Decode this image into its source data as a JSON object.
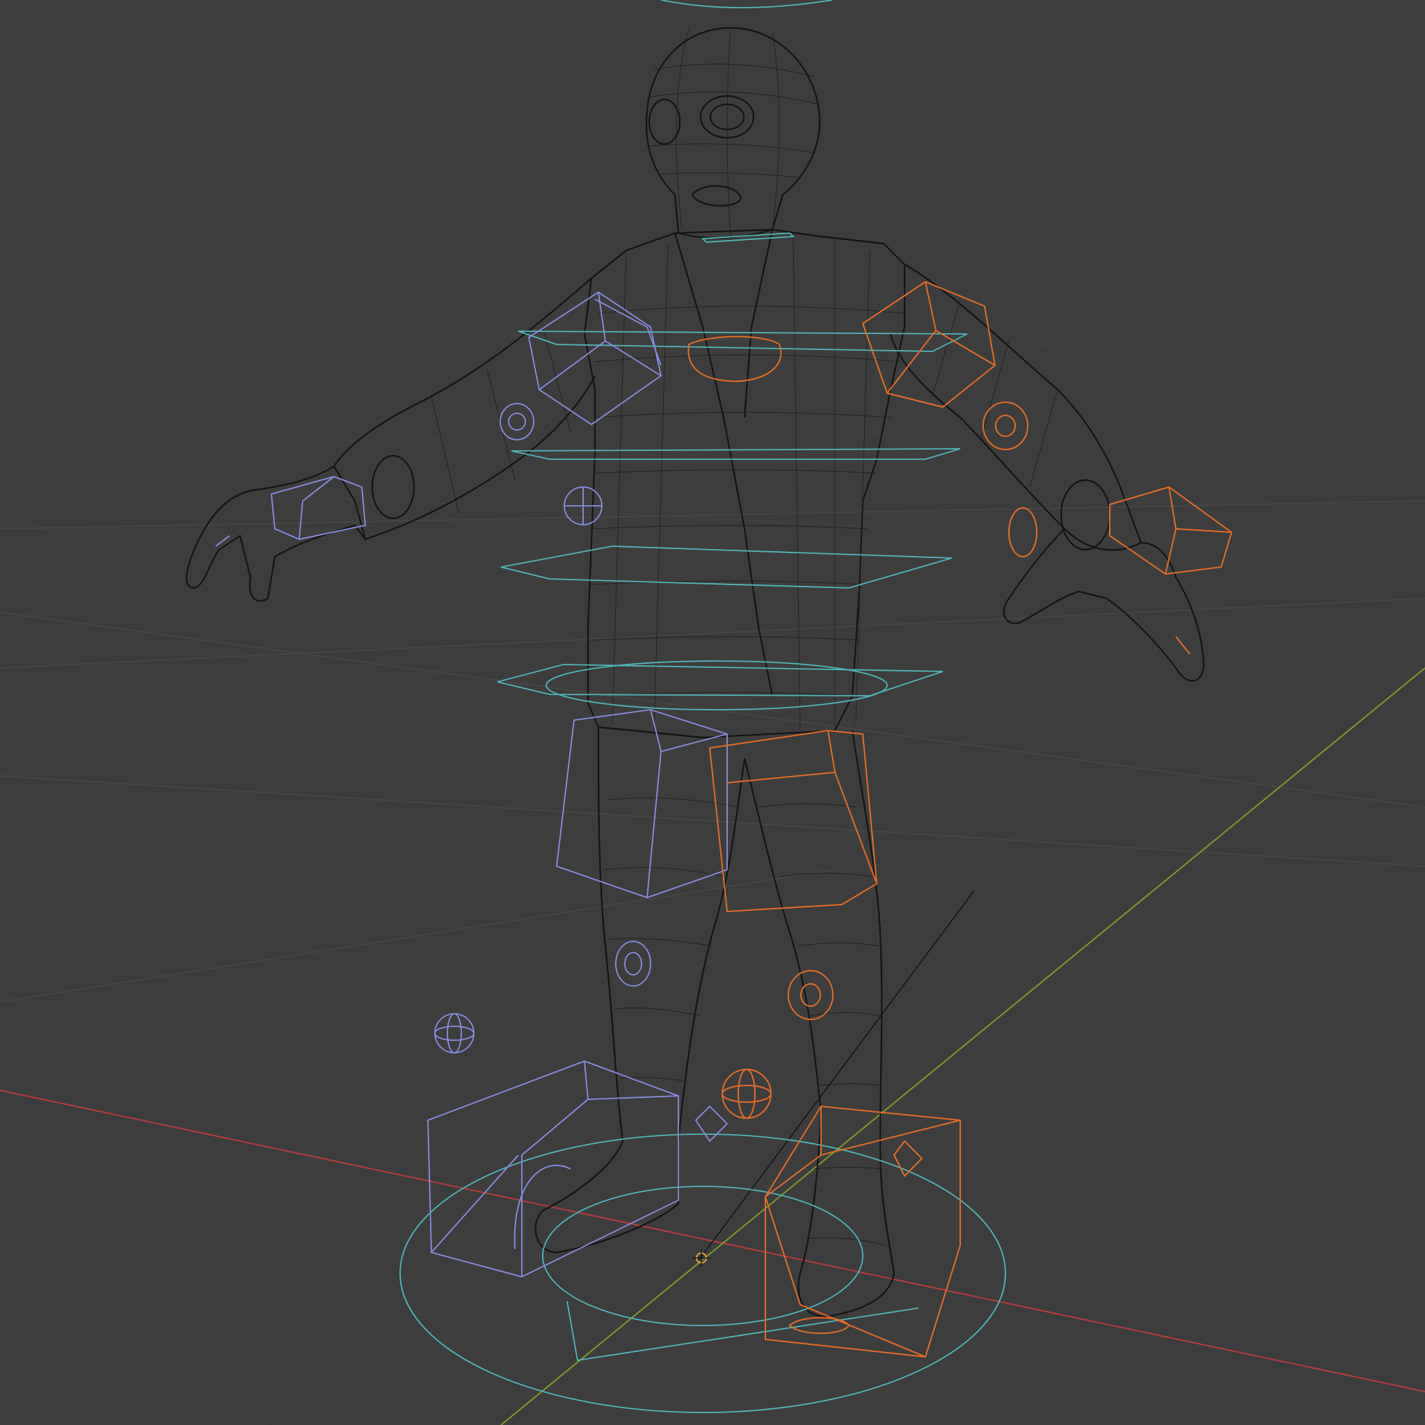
{
  "viewport": {
    "shading": "wireframe"
  },
  "colors": {
    "background": "#3d3d3d",
    "grid": "#4a4a4a",
    "x_axis": "#b83a3e",
    "y_axis": "#7d9a2a",
    "mesh_wire": "#141414",
    "control_left": "#8a8ee6",
    "control_right": "#e46c26",
    "control_center": "#4fb8bb",
    "origin_marker": "#e8a040"
  },
  "icons": {
    "origin": "origin-marker-icon",
    "root_control": "root-circle-control"
  }
}
